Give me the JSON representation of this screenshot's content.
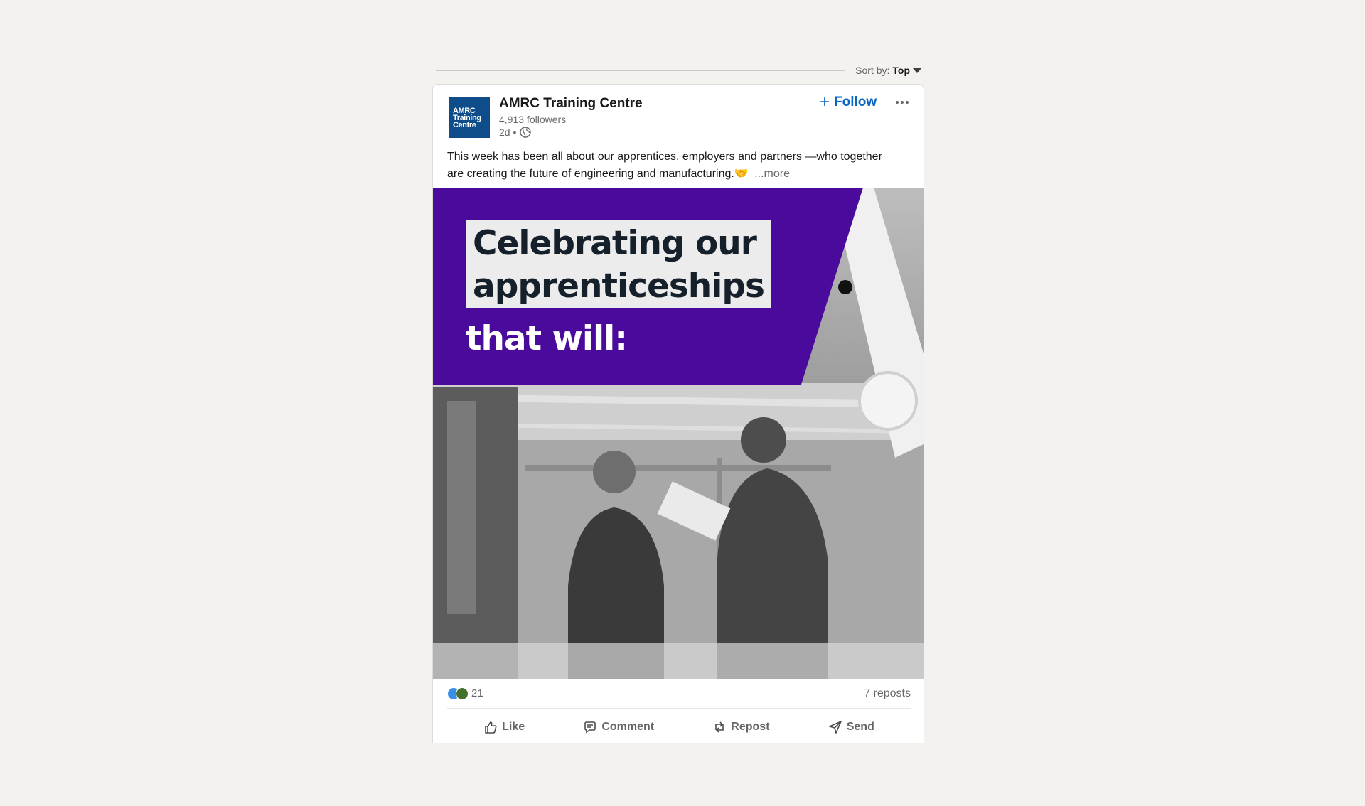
{
  "feed": {
    "sort_label": "Sort by:",
    "sort_value": "Top"
  },
  "post": {
    "author": {
      "name": "AMRC Training Centre",
      "logo_text": [
        "AMRC",
        "Training",
        "Centre"
      ],
      "followers": "4,913 followers",
      "time": "2d •"
    },
    "follow_label": "Follow",
    "text": "This week has been all about our apprentices, employers and partners —who together are creating the future of engineering and manufacturing.",
    "emoji": "🤝",
    "more_label": "...more",
    "image": {
      "headline_line1": "Celebrating our",
      "headline_line2": "apprenticeships",
      "headline_line3": "that will:"
    },
    "reaction_count": "21",
    "reposts": "7 reposts",
    "actions": {
      "like": "Like",
      "comment": "Comment",
      "repost": "Repost",
      "send": "Send"
    }
  },
  "colors": {
    "page_bg": "#f3f2ef",
    "brand_blue": "#0a66c2",
    "banner_purple": "#4a0a9c",
    "logo_blue": "#0f4c8a"
  }
}
